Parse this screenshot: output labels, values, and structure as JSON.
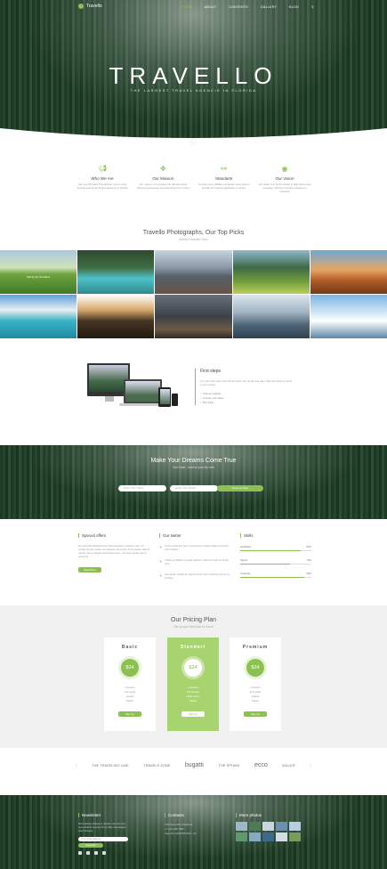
{
  "brand": {
    "name": "Travello",
    "accent": "#8cc152"
  },
  "nav": {
    "items": [
      "HOME",
      "ABOUT",
      "CONTENTS",
      "GALLERY",
      "BLOG"
    ],
    "search_icon": "search-icon"
  },
  "hero": {
    "title": "TRAVELLO",
    "subtitle": "THE LARGEST TRAVEL AGENCIE IN FLORIDA"
  },
  "features": [
    {
      "icon": "megaphone-icon",
      "title": "Who We Are",
      "text": "Far from 30 years TravelloTour covers a big area all around the largest agencies in Florida"
    },
    {
      "icon": "compass-icon",
      "title": "Our Mission",
      "text": "Our mission is to provide the ultimate travel planning experience and accounting for content"
    },
    {
      "icon": "share-icon",
      "title": "Standarts",
      "text": "Travello every affiliate companies work hard to provide the highest standards of service"
    },
    {
      "icon": "eye-icon",
      "title": "Our Vision",
      "text": "Our vision is to be the leader in high-level travel coverage, offering complete solutions to travelers"
    }
  ],
  "photos": {
    "title": "Travello Photographs, Our Top Picks",
    "subtitle": "Weekly Featured Tours",
    "first_caption": "Hiking trip Scotland"
  },
  "first_steps": {
    "title": "First steps",
    "text": "You can write your main first text here. Do simple and easy. Take the steps to travel to your dream",
    "items": [
      "Visit our website",
      "Choose your place",
      "Buy ticket"
    ]
  },
  "dreams": {
    "title": "Make Your Dreams Come True",
    "subtitle": "Don't wait - reserve your trip now",
    "name_placeholder": "Enter Your Name",
    "email_placeholder": "Enter Your Email",
    "button": "Reserve Now"
  },
  "columns": {
    "offers": {
      "title": "Special offers",
      "text": "We Has both dedicated team that specialize in cruises, bars, car rentals, private rentals, tour designs, ski resorts, luxury hotels, villas & resorts, luxury escapes and honeymoons - we treat you like part of our family",
      "button": "Read More"
    },
    "twitter": {
      "title": "Our twitter",
      "tweets": [
        "Such a great day here in Tennessee! Lookout Valley and Rock City Gardens",
        "Thank you Bobby for great vacation! I will come with my family soon",
        "Nice week. Thanks for awesome tour here. Nothing is as on my birthday"
      ]
    },
    "skills": {
      "title": "Skills",
      "items": [
        {
          "label": "Reliability",
          "value": 85,
          "text": "85%"
        },
        {
          "label": "Speed",
          "value": 70,
          "text": "70%"
        },
        {
          "label": "Creativity",
          "value": 90,
          "text": "90%"
        }
      ]
    }
  },
  "pricing": {
    "title": "Our Pricing Plan",
    "subtitle": "Set up your ideal plan for travel",
    "plans": [
      {
        "name": "Basic",
        "price": "$24",
        "features": [
          "Licenses",
          "Live guide",
          "Hotels",
          "Meals"
        ],
        "button": "Sign Up"
      },
      {
        "name": "Standart",
        "price": "$24",
        "features": [
          "Licenses",
          "Full service",
          "Hotel rooms",
          "Meals"
        ],
        "button": "Sign Up"
      },
      {
        "name": "Premium",
        "price": "$24",
        "features": [
          "Licenses",
          "Full guide",
          "Hotels",
          "Meals"
        ],
        "button": "Sign Up"
      }
    ]
  },
  "partners": [
    "THE TRAVELING LINE",
    "TRAVELS ZONE",
    "bugatti",
    "THE SPHINX",
    "ecco",
    "MILLER"
  ],
  "footer": {
    "newsletter": {
      "title": "Newsletter",
      "text": "We're always looking to provide more not only new products to enjoy but to offer new designs when bringing",
      "placeholder": "Your email address",
      "button": "Subscribe"
    },
    "contacts": {
      "title": "Contacts",
      "items": [
        "1234 Street Rd, Orlando FL",
        "+1 (123) 456-7890",
        "Open from 9AM-5PM Mon - Fri"
      ]
    },
    "photos": {
      "title": "More photos"
    }
  }
}
